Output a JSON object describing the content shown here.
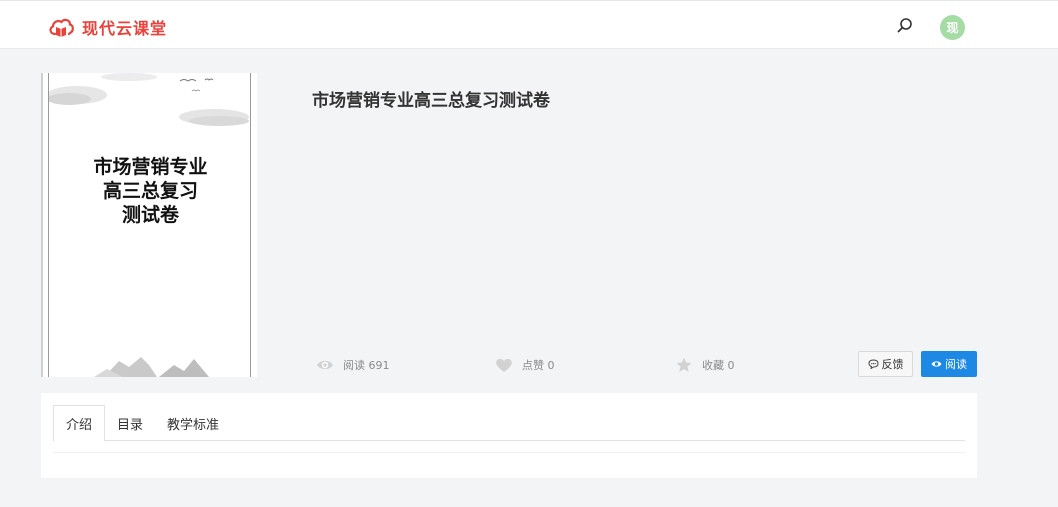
{
  "header": {
    "brand_name": "现代云课堂",
    "brand_color": "#e8423b",
    "logo_icon": "cloud-book-icon",
    "search_icon": "search-icon",
    "avatar_text": "现"
  },
  "document": {
    "title": "市场营销专业高三总复习测试卷",
    "cover_title_lines": [
      "市场营销专业",
      "高三总复习",
      "测试卷"
    ]
  },
  "stats": {
    "read_label": "阅读 691",
    "like_label": "点赞 0",
    "favorite_label": "收藏 0"
  },
  "actions": {
    "feedback_label": "反馈",
    "read_label": "阅读",
    "read_button_color": "#1e88e5"
  },
  "tabs": [
    {
      "label": "介绍",
      "active": true
    },
    {
      "label": "目录",
      "active": false
    },
    {
      "label": "教学标准",
      "active": false
    }
  ]
}
